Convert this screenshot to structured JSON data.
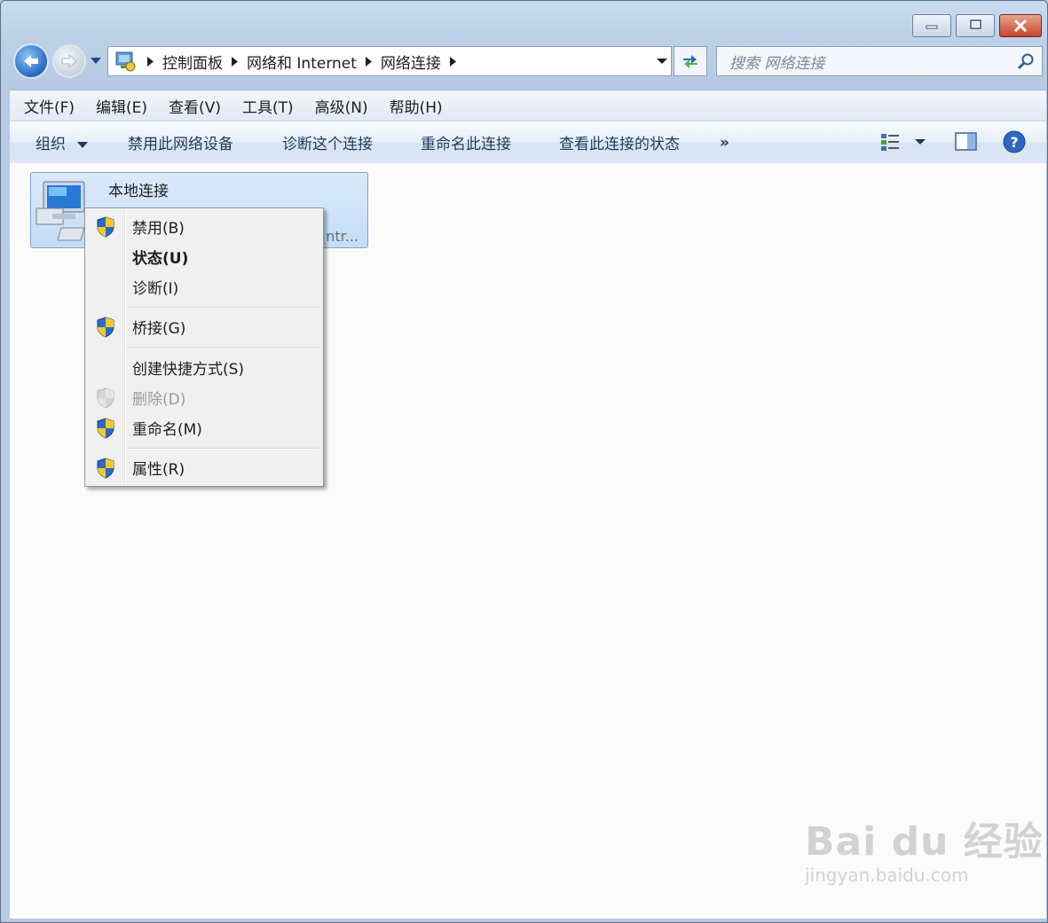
{
  "window": {
    "caption": {
      "minimize": "minimize",
      "restore": "restore",
      "close": "close"
    }
  },
  "address": {
    "crumbs": [
      "控制面板",
      "网络和 Internet",
      "网络连接"
    ]
  },
  "search": {
    "placeholder": "搜索 网络连接"
  },
  "menubar": {
    "items": [
      "文件(F)",
      "编辑(E)",
      "查看(V)",
      "工具(T)",
      "高级(N)",
      "帮助(H)"
    ]
  },
  "commandbar": {
    "organize": "组织",
    "disable": "禁用此网络设备",
    "diagnose": "诊断这个连接",
    "rename": "重命名此连接",
    "status": "查看此连接的状态",
    "more": "»"
  },
  "content": {
    "item": {
      "name": "本地连接",
      "sub": "ntr..."
    }
  },
  "context_menu": {
    "items": [
      {
        "label": "禁用(B)",
        "shield": true,
        "bold": false,
        "disabled": false
      },
      {
        "label": "状态(U)",
        "shield": false,
        "bold": true,
        "disabled": false
      },
      {
        "label": "诊断(I)",
        "shield": false,
        "bold": false,
        "disabled": false
      },
      {
        "label": "桥接(G)",
        "shield": true,
        "bold": false,
        "disabled": false
      },
      {
        "label": "创建快捷方式(S)",
        "shield": false,
        "bold": false,
        "disabled": false
      },
      {
        "label": "删除(D)",
        "shield": true,
        "bold": false,
        "disabled": true
      },
      {
        "label": "重命名(M)",
        "shield": true,
        "bold": false,
        "disabled": false
      },
      {
        "label": "属性(R)",
        "shield": true,
        "bold": false,
        "disabled": false
      }
    ]
  },
  "watermark": {
    "main": "Bai du 经验",
    "url": "jingyan.baidu.com"
  }
}
